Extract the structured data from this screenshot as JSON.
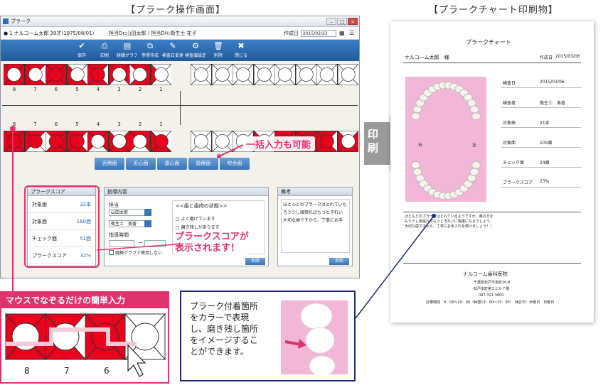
{
  "titles": {
    "left": "【プラーク操作画面】",
    "right": "【プラークチャート印刷物】"
  },
  "window": {
    "title": "プラーク",
    "patient_info": "1 ナルコーム太郎 39才(1975/08/01)",
    "doctors": "担当Dr:山田太郎 / 担当DH:衛生士 花子",
    "created_label": "作成日",
    "created_value": "2015/02/23"
  },
  "toolbar": [
    {
      "label": "保存",
      "icon": "✔"
    },
    {
      "label": "印刷",
      "icon": "⎙"
    },
    {
      "label": "経緯グラフ",
      "icon": "▤"
    },
    {
      "label": "参照作成",
      "icon": "⧉"
    },
    {
      "label": "検査日変更",
      "icon": "✎"
    },
    {
      "label": "検査値設定",
      "icon": "⚙"
    },
    {
      "label": "削除",
      "icon": "🗑"
    },
    {
      "label": "閉じる",
      "icon": "✖"
    }
  ],
  "tooth_numbers_upper": [
    "8",
    "7",
    "6",
    "5",
    "4",
    "3",
    "2",
    "1"
  ],
  "tooth_numbers_lower": [
    "8",
    "7",
    "6",
    "5",
    "4",
    "3",
    "2",
    "1"
  ],
  "surface_buttons": [
    "舌側面",
    "近心面",
    "遠心面",
    "唇側面",
    "咬合面"
  ],
  "score_panel": {
    "title": "プラークスコア",
    "rows": [
      {
        "label": "対象歯",
        "value": "32本"
      },
      {
        "label": "対象面",
        "value": "160面"
      },
      {
        "label": "チェック面",
        "value": "51面"
      },
      {
        "label": "プラークスコア",
        "value": "32%"
      }
    ]
  },
  "guidance_panel": {
    "title": "指導内容",
    "staff_label": "担当",
    "staff1": "山田太郎",
    "staff2": "衛生士　美香",
    "time_label": "指導時間",
    "time_sep": "~",
    "graph_check": "経緯グラフで使用しない",
    "state_title": "<<歯と歯肉の状態>>",
    "state_items": [
      "よく磨けています",
      "磨き残しがあります"
    ],
    "ref_button": "参照"
  },
  "note_panel": {
    "title": "備考",
    "text": "ほとんどのプラークはとれていも ろう少し頑張ればもっときれい 大切な歯ですから、丁寧にお手",
    "ref_button": "参照"
  },
  "callouts": {
    "bulk": "一括入力も可能",
    "score": "プラークスコアが\n表示されます！",
    "mouse": "マウスでなぞるだけの簡単入力"
  },
  "zoom_numbers": [
    "8",
    "7",
    "6"
  ],
  "print_arrow": "印刷",
  "sheet": {
    "title": "プラークチャート",
    "patient": "ナルコーム太郎　様",
    "created_label": "作成日",
    "created": "2015/03/06",
    "right_label": "右",
    "left_label": "左",
    "rows": [
      {
        "label": "検査日",
        "value": "2015/03/06"
      },
      {
        "label": "検査者",
        "value": "衛生士　美香"
      },
      {
        "label": "対象歯",
        "value": "21本"
      },
      {
        "label": "対象面",
        "value": "105面"
      },
      {
        "label": "チェック面",
        "value": "24面"
      },
      {
        "label": "プラークスコア",
        "value": "23%"
      }
    ],
    "comment": "ほとんどのプラークはとれているようですが、奥の方を\nもう少し頑張ればもっときれいに保護になるでしょう。\n大切な歯ですから、丁寧にお手入れを続けましょう！！",
    "clinic": "ナルコーム歯科医院",
    "address1": "千葉県松戸市本町20-8",
    "address2": "松戸本町第２ビル７階",
    "phone": "047-311-3600",
    "hours": "診療時間　9：00～20：00（休憩13：00～15：00）　休診日：木曜日　日曜日"
  },
  "info_box": "プラーク付着箇所\nをカラーで表現\nし、磨き残し箇所\nをイメージするこ\nとができます。",
  "colors": {
    "plaque": "#e8001c",
    "accent": "#e0336e",
    "toolbar": "#2e6db3",
    "navy": "#1e2a78"
  }
}
